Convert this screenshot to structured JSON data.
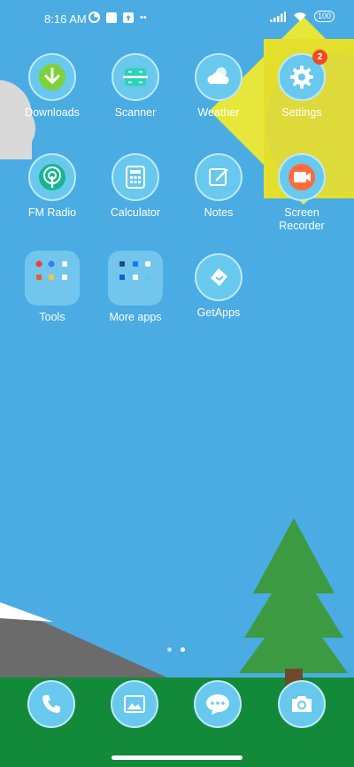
{
  "status_bar": {
    "time": "8:16 AM",
    "battery": "100"
  },
  "apps": [
    {
      "id": "downloads",
      "label": "Downloads"
    },
    {
      "id": "scanner",
      "label": "Scanner"
    },
    {
      "id": "weather",
      "label": "Weather"
    },
    {
      "id": "settings",
      "label": "Settings",
      "badge": "2"
    },
    {
      "id": "fm-radio",
      "label": "FM Radio"
    },
    {
      "id": "calculator",
      "label": "Calculator"
    },
    {
      "id": "notes",
      "label": "Notes"
    },
    {
      "id": "screen-recorder",
      "label": "Screen\nRecorder"
    },
    {
      "id": "tools",
      "label": "Tools"
    },
    {
      "id": "more-apps",
      "label": "More apps"
    },
    {
      "id": "getapps",
      "label": "GetApps"
    }
  ],
  "page_indicator": {
    "pages": 2,
    "current": 2
  },
  "dock": [
    {
      "id": "phone"
    },
    {
      "id": "gallery"
    },
    {
      "id": "messages"
    },
    {
      "id": "camera"
    }
  ]
}
